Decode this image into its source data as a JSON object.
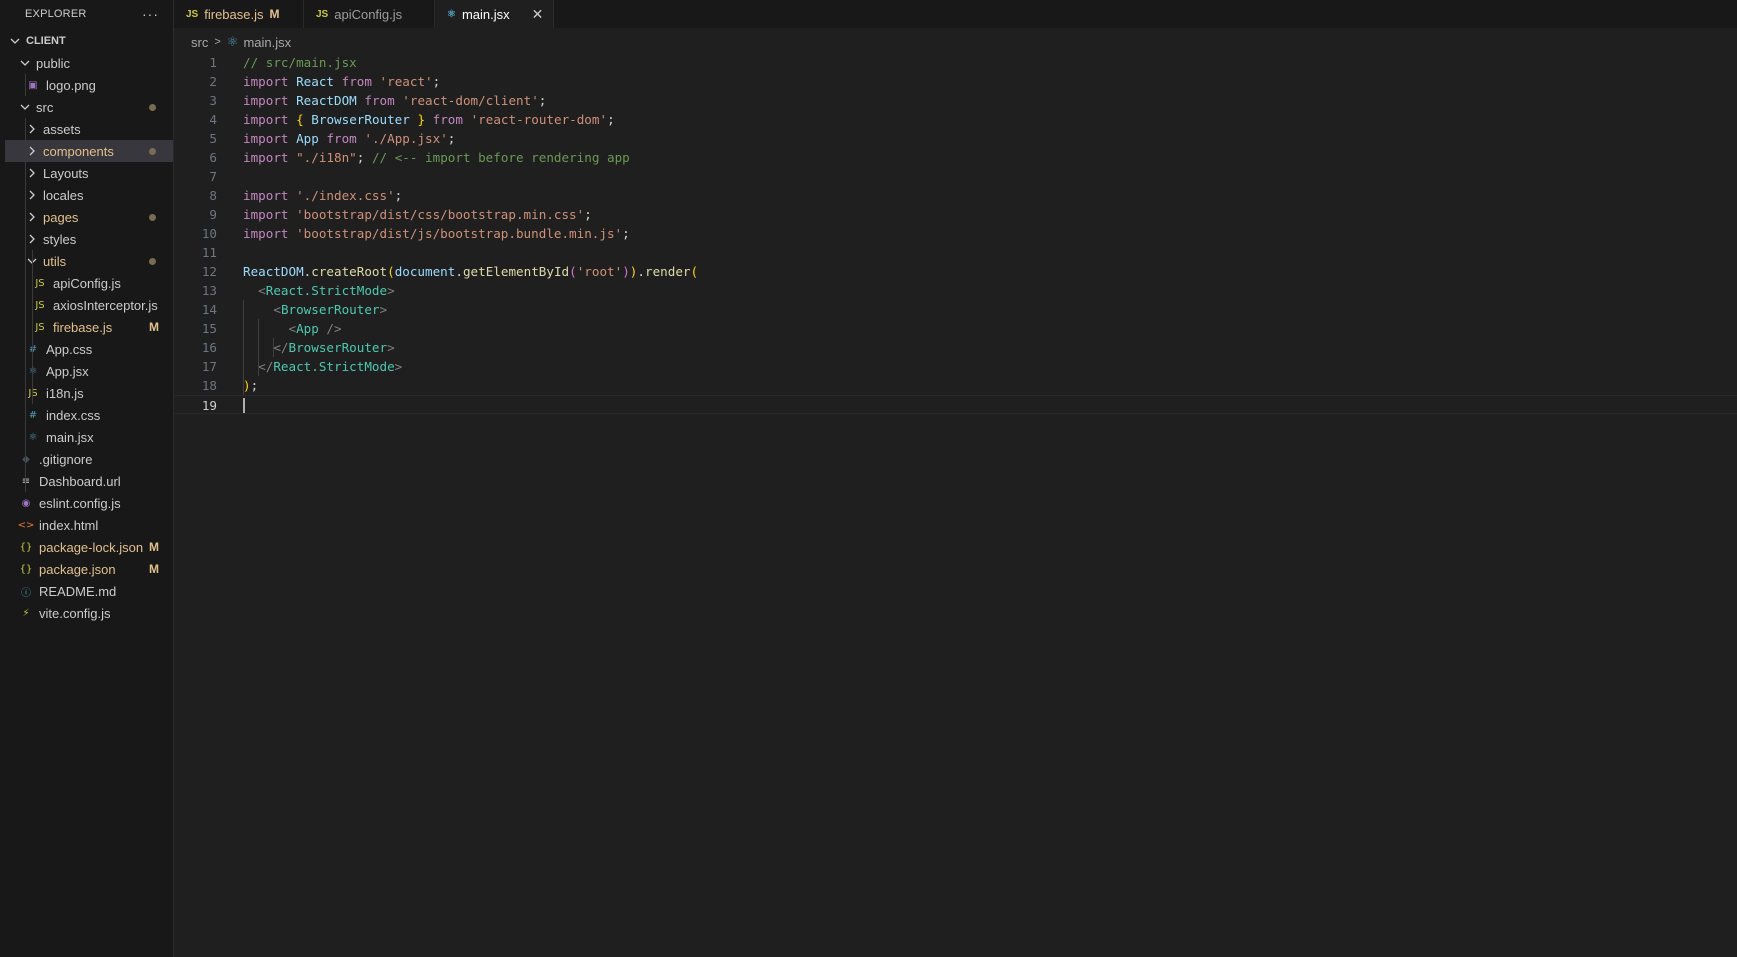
{
  "explorer": {
    "title": "EXPLORER",
    "more": "···",
    "root": "CLIENT",
    "items": [
      {
        "label": "public",
        "kind": "folder",
        "open": true
      },
      {
        "label": "logo.png",
        "icon": "▣",
        "icon_color": "#a074c4"
      },
      {
        "label": "src",
        "kind": "folder",
        "open": true,
        "dot": true
      },
      {
        "label": "assets",
        "kind": "folder",
        "open": false
      },
      {
        "label": "components",
        "kind": "folder",
        "open": false,
        "dot": true,
        "modified": true,
        "selected": true
      },
      {
        "label": "Layouts",
        "kind": "folder",
        "open": false
      },
      {
        "label": "locales",
        "kind": "folder",
        "open": false
      },
      {
        "label": "pages",
        "kind": "folder",
        "open": false,
        "dot": true,
        "modified": true
      },
      {
        "label": "styles",
        "kind": "folder",
        "open": false
      },
      {
        "label": "utils",
        "kind": "folder",
        "open": true,
        "dot": true,
        "modified": true
      },
      {
        "label": "apiConfig.js",
        "icon": "JS",
        "icon_color": "#cbcb41"
      },
      {
        "label": "axiosInterceptor.js",
        "icon": "JS",
        "icon_color": "#cbcb41"
      },
      {
        "label": "firebase.js",
        "icon": "JS",
        "icon_color": "#cbcb41",
        "badge": "M",
        "modified": true
      },
      {
        "label": "App.css",
        "icon": "#",
        "icon_color": "#519aba"
      },
      {
        "label": "App.jsx",
        "icon": "⚛",
        "icon_color": "#519aba"
      },
      {
        "label": "i18n.js",
        "icon": "JS",
        "icon_color": "#cbcb41"
      },
      {
        "label": "index.css",
        "icon": "#",
        "icon_color": "#519aba"
      },
      {
        "label": "main.jsx",
        "icon": "⚛",
        "icon_color": "#519aba"
      },
      {
        "label": ".gitignore",
        "icon": "◆",
        "icon_color": "#41535b"
      },
      {
        "label": "Dashboard.url",
        "icon": "≡",
        "icon_color": "#cccccc"
      },
      {
        "label": "eslint.config.js",
        "icon": "◉",
        "icon_color": "#a074c4"
      },
      {
        "label": "index.html",
        "icon": "<>",
        "icon_color": "#e37933"
      },
      {
        "label": "package-lock.json",
        "icon": "{}",
        "icon_color": "#cbcb41",
        "badge": "M",
        "modified": true
      },
      {
        "label": "package.json",
        "icon": "{}",
        "icon_color": "#cbcb41",
        "badge": "M",
        "modified": true
      },
      {
        "label": "README.md",
        "icon": "ⓘ",
        "icon_color": "#519aba"
      },
      {
        "label": "vite.config.js",
        "icon": "⚡",
        "icon_color": "#cbcb41"
      }
    ]
  },
  "tabs": [
    {
      "label": "firebase.js",
      "icon": "JS",
      "icon_color": "#cbcb41",
      "badge": "M",
      "modified": true
    },
    {
      "label": "apiConfig.js",
      "icon": "JS",
      "icon_color": "#cbcb41"
    },
    {
      "label": "main.jsx",
      "icon": "⚛",
      "icon_color": "#519aba",
      "active": true,
      "close": "✕"
    }
  ],
  "breadcrumb": {
    "folder": "src",
    "sep": ">",
    "file": "main.jsx"
  },
  "editor": {
    "current_line": 19,
    "lines": [
      [
        [
          "// src/main.jsx",
          "cm"
        ]
      ],
      [
        [
          "import",
          "kw"
        ],
        [
          " ",
          "p"
        ],
        [
          "React",
          "var"
        ],
        [
          " ",
          "p"
        ],
        [
          "from",
          "kw"
        ],
        [
          " ",
          "p"
        ],
        [
          "'react'",
          "str"
        ],
        [
          ";",
          "p"
        ]
      ],
      [
        [
          "import",
          "kw"
        ],
        [
          " ",
          "p"
        ],
        [
          "ReactDOM",
          "var"
        ],
        [
          " ",
          "p"
        ],
        [
          "from",
          "kw"
        ],
        [
          " ",
          "p"
        ],
        [
          "'react-dom/client'",
          "str"
        ],
        [
          ";",
          "p"
        ]
      ],
      [
        [
          "import",
          "kw"
        ],
        [
          " ",
          "p"
        ],
        [
          "{",
          "b1"
        ],
        [
          " ",
          "p"
        ],
        [
          "BrowserRouter",
          "var"
        ],
        [
          " ",
          "p"
        ],
        [
          "}",
          "b1"
        ],
        [
          " ",
          "p"
        ],
        [
          "from",
          "kw"
        ],
        [
          " ",
          "p"
        ],
        [
          "'react-router-dom'",
          "str"
        ],
        [
          ";",
          "p"
        ]
      ],
      [
        [
          "import",
          "kw"
        ],
        [
          " ",
          "p"
        ],
        [
          "App",
          "var"
        ],
        [
          " ",
          "p"
        ],
        [
          "from",
          "kw"
        ],
        [
          " ",
          "p"
        ],
        [
          "'./App.jsx'",
          "str"
        ],
        [
          ";",
          "p"
        ]
      ],
      [
        [
          "import",
          "kw"
        ],
        [
          " ",
          "p"
        ],
        [
          "\"./i18n\"",
          "str"
        ],
        [
          ";",
          "p"
        ],
        [
          " ",
          "p"
        ],
        [
          "// <-- import before rendering app",
          "cm"
        ]
      ],
      [],
      [
        [
          "import",
          "kw"
        ],
        [
          " ",
          "p"
        ],
        [
          "'./index.css'",
          "str"
        ],
        [
          ";",
          "p"
        ]
      ],
      [
        [
          "import",
          "kw"
        ],
        [
          " ",
          "p"
        ],
        [
          "'bootstrap/dist/css/bootstrap.min.css'",
          "str"
        ],
        [
          ";",
          "p"
        ]
      ],
      [
        [
          "import",
          "kw"
        ],
        [
          " ",
          "p"
        ],
        [
          "'bootstrap/dist/js/bootstrap.bundle.min.js'",
          "str"
        ],
        [
          ";",
          "p"
        ]
      ],
      [],
      [
        [
          "ReactDOM",
          "var"
        ],
        [
          ".",
          "p"
        ],
        [
          "createRoot",
          "fn"
        ],
        [
          "(",
          "b1"
        ],
        [
          "document",
          "var"
        ],
        [
          ".",
          "p"
        ],
        [
          "getElementById",
          "fn"
        ],
        [
          "(",
          "b2"
        ],
        [
          "'root'",
          "str"
        ],
        [
          ")",
          "b2"
        ],
        [
          ")",
          "b1"
        ],
        [
          ".",
          "p"
        ],
        [
          "render",
          "fn"
        ],
        [
          "(",
          "b1"
        ]
      ],
      [
        [
          "  ",
          "p"
        ],
        [
          "<",
          "tag"
        ],
        [
          "React.StrictMode",
          "cls"
        ],
        [
          ">",
          "tag"
        ]
      ],
      [
        [
          "    ",
          "p"
        ],
        [
          "<",
          "tag"
        ],
        [
          "BrowserRouter",
          "cls"
        ],
        [
          ">",
          "tag"
        ]
      ],
      [
        [
          "      ",
          "p"
        ],
        [
          "<",
          "tag"
        ],
        [
          "App",
          "cls"
        ],
        [
          " />",
          "tag"
        ]
      ],
      [
        [
          "    ",
          "p"
        ],
        [
          "</",
          "tag"
        ],
        [
          "BrowserRouter",
          "cls"
        ],
        [
          ">",
          "tag"
        ]
      ],
      [
        [
          "  ",
          "p"
        ],
        [
          "</",
          "tag"
        ],
        [
          "React.StrictMode",
          "cls"
        ],
        [
          ">",
          "tag"
        ]
      ],
      [
        [
          ")",
          "b1"
        ],
        [
          ";",
          "p"
        ]
      ],
      []
    ]
  }
}
